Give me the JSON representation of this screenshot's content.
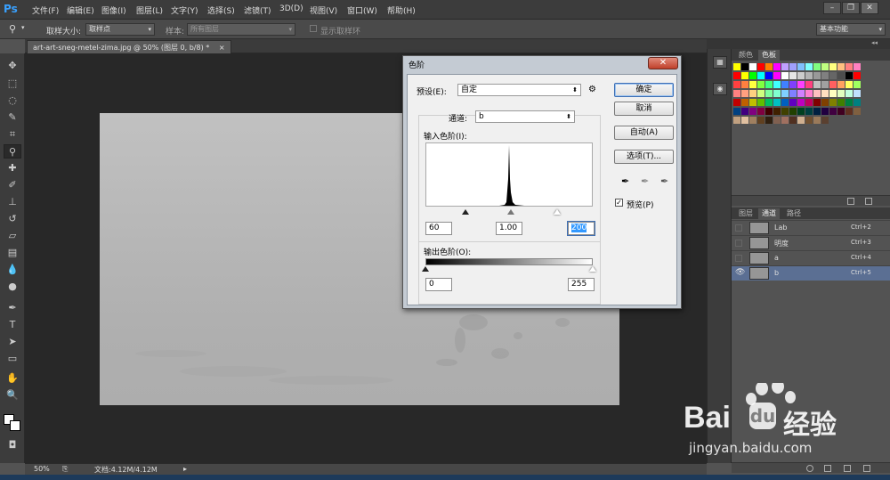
{
  "menubar": {
    "logo": "Ps",
    "items": [
      "文件(F)",
      "编辑(E)",
      "图像(I)",
      "图层(L)",
      "文字(Y)",
      "选择(S)",
      "滤镜(T)",
      "3D(D)",
      "视图(V)",
      "窗口(W)",
      "帮助(H)"
    ],
    "window_buttons": [
      "–",
      "❐",
      "✕"
    ]
  },
  "options": {
    "sample_size_label": "取样大小:",
    "sample_size_value": "取样点",
    "sample_label": "样本:",
    "sample_value": "所有图层",
    "show_ring_label": "显示取样环",
    "workspace": "基本功能"
  },
  "document": {
    "tab_title": "art-art-sneg-metel-zima.jpg @ 50% (图层 0, b/8) *",
    "close": "×"
  },
  "status": {
    "zoom": "50%",
    "doc_info": "文档:4.12M/4.12M"
  },
  "panels": {
    "swatch_tabs": [
      "颜色",
      "色板"
    ],
    "channel_tabs": [
      "图层",
      "通道",
      "路径"
    ],
    "channels": [
      {
        "name": "Lab",
        "shortcut": "Ctrl+2"
      },
      {
        "name": "明度",
        "shortcut": "Ctrl+3"
      },
      {
        "name": "a",
        "shortcut": "Ctrl+4"
      },
      {
        "name": "b",
        "shortcut": "Ctrl+5"
      }
    ],
    "collapse_arrows": "◂◂",
    "swatch_rows": [
      [
        "#ffff00",
        "#000000",
        "#ffffff",
        "#ff0000",
        "#ff8000",
        "#ff00ff",
        "#c0a0ff",
        "#a0a0ff",
        "#80c0ff",
        "#80ffff",
        "#80ff80",
        "#c0ff80",
        "#ffff80",
        "#ffc080",
        "#ff8080",
        "#ff80c0"
      ],
      [
        "#ff0000",
        "#ffff00",
        "#00ff00",
        "#00ffff",
        "#0000ff",
        "#ff00ff",
        "#ffffff",
        "#e6e6e6",
        "#cccccc",
        "#b3b3b3",
        "#999999",
        "#808080",
        "#666666",
        "#4d4d4d",
        "#000000",
        "#ff0000"
      ],
      [
        "#ff4040",
        "#ff8040",
        "#ffff40",
        "#80ff40",
        "#40ff80",
        "#40ffff",
        "#4080ff",
        "#8040ff",
        "#ff40ff",
        "#ff4080",
        "#c0c0c0",
        "#a0a0a0",
        "#ff6060",
        "#ffa060",
        "#ffff60",
        "#a0ff60"
      ],
      [
        "#ff8080",
        "#ffa080",
        "#ffd080",
        "#d0ff80",
        "#80ffa0",
        "#80ffd0",
        "#80d0ff",
        "#8080ff",
        "#d080ff",
        "#ff80d0",
        "#ffc0c0",
        "#ffe0c0",
        "#ffffc0",
        "#e0ffc0",
        "#c0ffe0",
        "#c0e0ff"
      ],
      [
        "#c00000",
        "#c06000",
        "#c0c000",
        "#60c000",
        "#00c060",
        "#00c0c0",
        "#0060c0",
        "#6000c0",
        "#c000c0",
        "#c00060",
        "#800000",
        "#804000",
        "#808000",
        "#408000",
        "#008040",
        "#008080"
      ],
      [
        "#004080",
        "#400080",
        "#800080",
        "#800040",
        "#400000",
        "#402000",
        "#404000",
        "#204000",
        "#004020",
        "#004040",
        "#002040",
        "#200040",
        "#400040",
        "#400020",
        "#603020",
        "#806040"
      ],
      [
        "#c0a080",
        "#e0c0a0",
        "#a08060",
        "#604020",
        "#302010",
        "#806050",
        "#a07060",
        "#503020",
        "#d0b090",
        "#705030",
        "#9a7a5a",
        "#5a4030"
      ]
    ]
  },
  "dialog": {
    "title": "色阶",
    "preset_label": "预设(E):",
    "preset_value": "自定",
    "channel_label": "通道:",
    "channel_value": "b",
    "input_levels_label": "输入色阶(I):",
    "input_black": "60",
    "input_gamma": "1.00",
    "input_white": "200",
    "output_levels_label": "输出色阶(O):",
    "output_black": "0",
    "output_white": "255",
    "ok": "确定",
    "cancel": "取消",
    "auto": "自动(A)",
    "options": "选项(T)...",
    "preview_label": "预览(P)",
    "preview_checked": true
  },
  "watermark": {
    "brand": "Bai",
    "brand2": "经验",
    "url": "jingyan.baidu.com"
  }
}
